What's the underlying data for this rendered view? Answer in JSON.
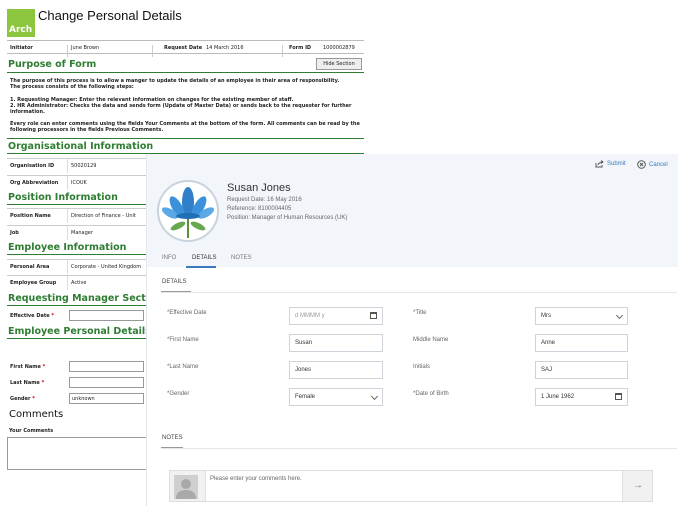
{
  "legacy": {
    "logo": "Arch",
    "title": "Change Personal Details",
    "header": {
      "initiator_label": "Initiator",
      "initiator_value": "June Brown",
      "request_date_label": "Request Date",
      "request_date_value": "14 March 2016",
      "form_id_label": "Form ID",
      "form_id_value": "1000002879"
    },
    "purpose": {
      "title": "Purpose of Form",
      "hide_button": "Hide Section",
      "p1": "The purpose of this process is to allow a manger to update the details of an employee in their area of responsibility.",
      "p2": "The process consists of the following steps:",
      "p3": "1. Requesting Manager: Enter the relevant information on changes for the existing member of staff.",
      "p4": "2. HR Administrator: Checks the data and sends form (Update of Master Data) or sends back to the requester for further information.",
      "p5": "Every role can enter comments using the fields Your Comments at the bottom of the form. All comments can be read by the following processors in the fields Previous Comments."
    },
    "org": {
      "title": "Organisational Information",
      "org_id_label": "Organisation ID",
      "org_id_value": "50020129",
      "org_abbr_label": "Org Abbreviation",
      "org_abbr_value": "ICOUK"
    },
    "position": {
      "title": "Position Information",
      "pos_name_label": "Position Name",
      "pos_name_value": "Direction of Finance - Unit",
      "job_label": "Job",
      "job_value": "Manager"
    },
    "employee": {
      "title": "Employee Information",
      "area_label": "Personal Area",
      "area_value": "Corporate - United Kingdom",
      "group_label": "Employee Group",
      "group_value": "Active"
    },
    "requesting": {
      "title": "Requesting Manager Section",
      "eff_date_label": "Effective Date",
      "req_mark": "*"
    },
    "personal": {
      "title": "Employee Personal Details",
      "first_name_label": "First Name",
      "last_name_label": "Last Name",
      "gender_label": "Gender",
      "gender_value": "unknown",
      "req_mark": "*"
    },
    "comments": {
      "title": "Comments",
      "your_comments_label": "Your Comments"
    }
  },
  "panel": {
    "submit": "Submit",
    "cancel": "Cancel",
    "name": "Susan Jones",
    "request_date": "Request Date: 16 May 2016",
    "reference": "Reference: 8100004405",
    "position": "Position: Manager of Human Resources (UK)",
    "tabs": [
      "INFO",
      "DETAILS",
      "NOTES"
    ],
    "details_title": "DETAILS",
    "notes_title": "NOTES",
    "fields": {
      "effective_date_label": "Effective Date",
      "effective_date_placeholder": "d MMMM y",
      "title_label": "Title",
      "title_value": "Mrs",
      "first_name_label": "First Name",
      "first_name_value": "Susan",
      "middle_name_label": "Middle Name",
      "middle_name_value": "Anne",
      "last_name_label": "Last Name",
      "last_name_value": "Jones",
      "initials_label": "Initials",
      "initials_value": "SAJ",
      "gender_label": "Gender",
      "gender_value": "Female",
      "dob_label": "Date of Birth",
      "dob_value": "1 June 1962",
      "req_mark": "*"
    },
    "comment_placeholder": "Please enter your comments here.",
    "send_icon": "→"
  }
}
